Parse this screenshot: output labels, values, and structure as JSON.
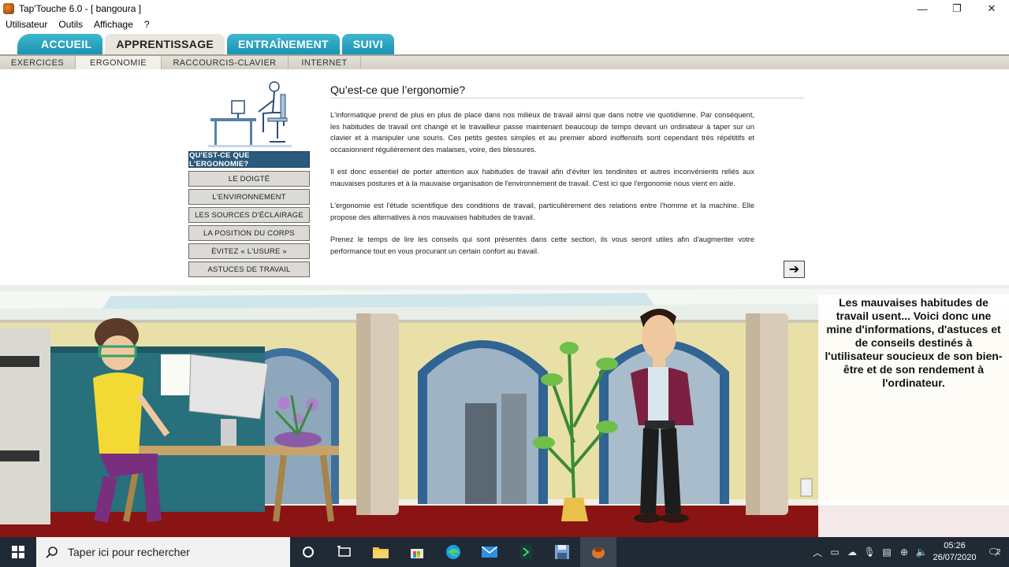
{
  "window": {
    "title": "Tap'Touche 6.0 - [ bangoura ]",
    "controls": {
      "minimize": "—",
      "maximize": "❐",
      "close": "✕"
    }
  },
  "menu": [
    "Utilisateur",
    "Outils",
    "Affichage",
    "?"
  ],
  "main_tabs": [
    {
      "label": "ACCUEIL",
      "active": false
    },
    {
      "label": "APPRENTISSAGE",
      "active": true
    },
    {
      "label": "ENTRAÎNEMENT",
      "active": false
    },
    {
      "label": "SUIVI",
      "active": false
    }
  ],
  "sub_tabs": [
    {
      "label": "EXERCICES",
      "active": false
    },
    {
      "label": "ERGONOMIE",
      "active": true
    },
    {
      "label": "RACCOURCIS-CLAVIER",
      "active": false
    },
    {
      "label": "INTERNET",
      "active": false
    }
  ],
  "side_nav": [
    {
      "label": "QU'EST-CE QUE L'ERGONOMIE?",
      "active": true
    },
    {
      "label": "LE DOIGTÉ",
      "active": false
    },
    {
      "label": "L'ENVIRONNEMENT",
      "active": false
    },
    {
      "label": "LES SOURCES D'ÉCLAIRAGE",
      "active": false
    },
    {
      "label": "LA POSITION DU CORPS",
      "active": false
    },
    {
      "label": "ÉVITEZ « L'USURE »",
      "active": false
    },
    {
      "label": "ASTUCES DE TRAVAIL",
      "active": false
    }
  ],
  "article": {
    "title": "Qu’est-ce que l’ergonomie?",
    "paragraphs": [
      "L'informatique prend de plus en plus de place dans nos milieux de travail ainsi que dans notre vie quotidienne. Par conséquent, les habitudes de travail ont changé et le travailleur passe maintenant beaucoup de temps devant un ordinateur à taper sur un clavier et à manipuler une souris. Ces petits gestes simples et au premier abord inoffensifs sont cependant très répétitifs et occasionnent régulièrement des malaises, voire, des blessures.",
      "Il est donc essentiel de porter attention aux habitudes de travail afin d'éviter les tendinites et autres inconvénients reliés aux mauvaises postures et à la mauvaise  organisation de l'environnement de travail. C'est ici que l'ergonomie nous vient en aide.",
      "L'ergonomie est l'étude scientifique des conditions de travail, particulièrement des relations entre l'homme et la machine. Elle propose des alternatives à nos mauvaises habitudes de travail.",
      "Prenez le temps de lire les conseils qui sont présentés dans cette section, ils vous seront utiles afin d'augmenter votre performance tout en vous procurant un certain confort au travail."
    ],
    "next_icon": "arrow-right-icon"
  },
  "scene_caption": "Les mauvaises habitudes de travail usent... Voici donc une mine d'informations, d'astuces et de conseils destinés à l'utilisateur soucieux de son bien-être et de son rendement à l'ordinateur.",
  "taskbar": {
    "search_placeholder": "Taper ici pour rechercher",
    "time": "05:26",
    "date": "26/07/2020",
    "notification_count": "2"
  },
  "colors": {
    "tab_blue": "#1b93b3",
    "nav_active": "#2b5a7c",
    "wall": "#e9e0a8",
    "floor": "#8a1414",
    "taskbar": "#1f2a35"
  }
}
